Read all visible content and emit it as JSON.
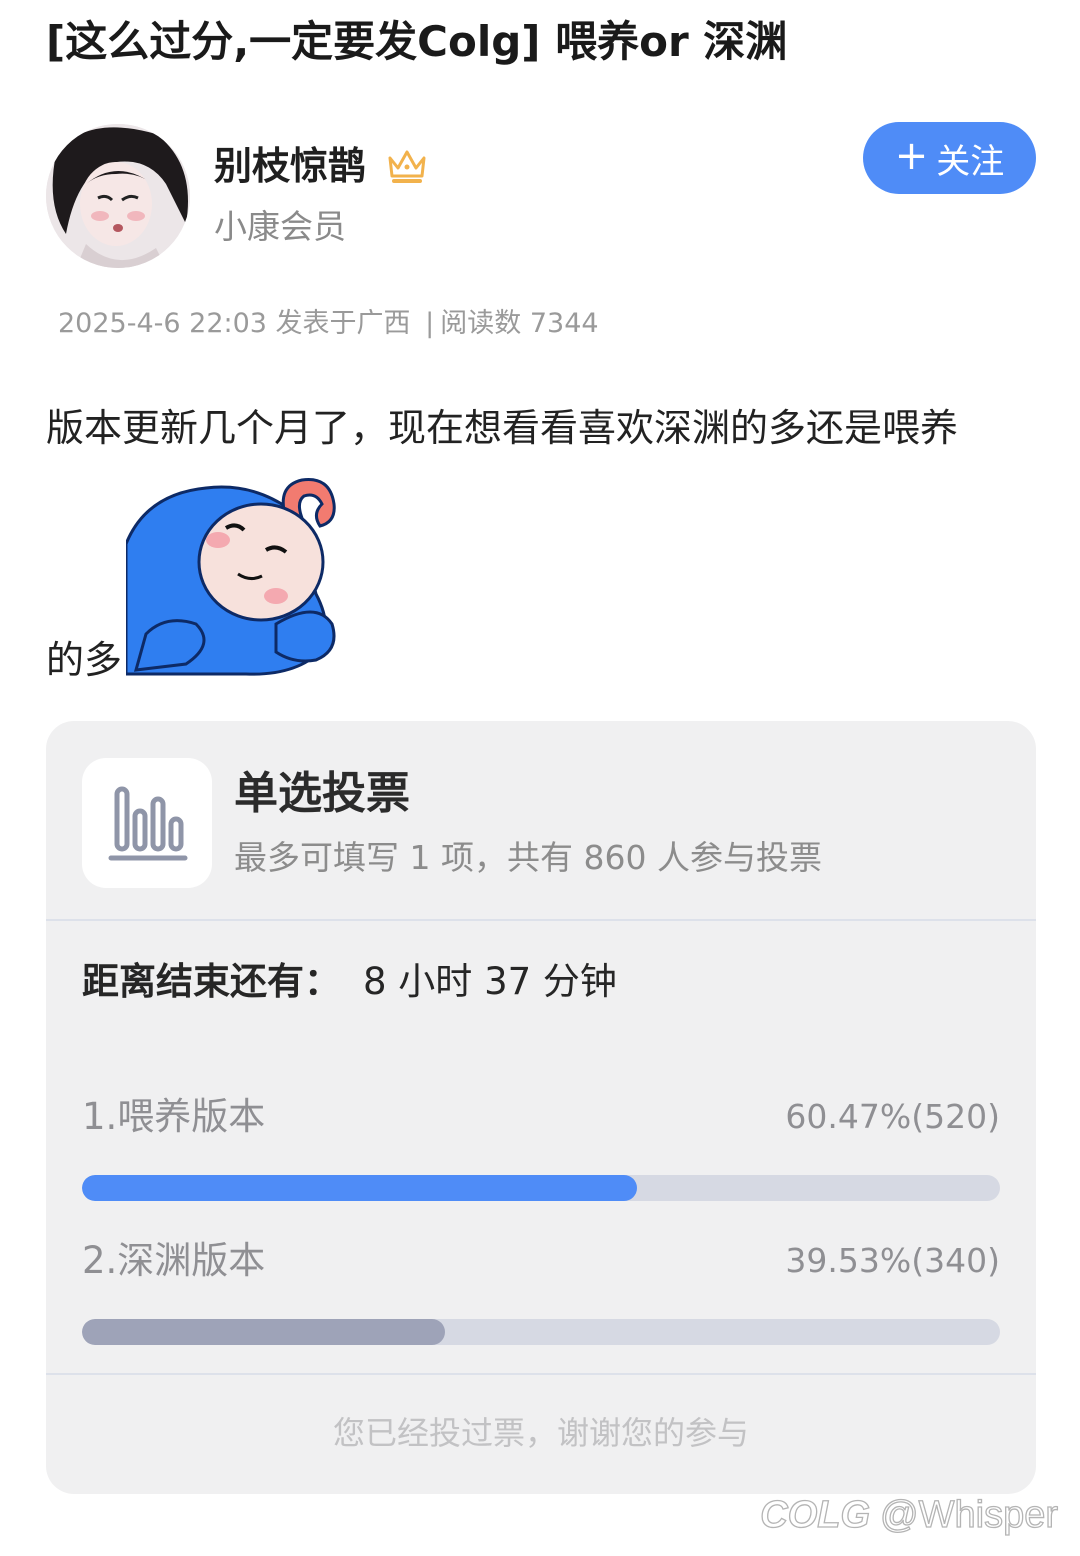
{
  "post": {
    "title": "[这么过分,一定要发Colg] 喂养or 深渊",
    "author": {
      "name": "别枝惊鹊",
      "badge_icon": "crown-icon",
      "member_level": "小康会员"
    },
    "follow_label": "关注",
    "follow_icon": "+",
    "meta": {
      "datetime": "2025-4-6 22:03",
      "location": "发表于广西",
      "separator": "|",
      "reads": "阅读数 7344"
    },
    "body_line1": "版本更新几个月了，现在想看看喜欢深渊的多还是喂养",
    "body_line2": "的多",
    "sticker": "blue-hooded-character-sticker"
  },
  "poll": {
    "icon": "bar-chart-icon",
    "title": "单选投票",
    "subtitle": "最多可填写 1 项，共有 860 人参与投票",
    "countdown_label": "距离结束还有：",
    "countdown_value": "8 小时 37 分钟",
    "options": [
      {
        "label": "1.喂养版本",
        "result": "60.47%(520)",
        "fraction": 0.6047,
        "color": "#4f8cf7"
      },
      {
        "label": "2.深渊版本",
        "result": "39.53%(340)",
        "fraction": 0.3953,
        "color": "#9ea3b8"
      }
    ],
    "voted_message": "您已经投过票，谢谢您的参与"
  },
  "watermark": {
    "logo": "COLG",
    "handle": "@Whisper"
  }
}
